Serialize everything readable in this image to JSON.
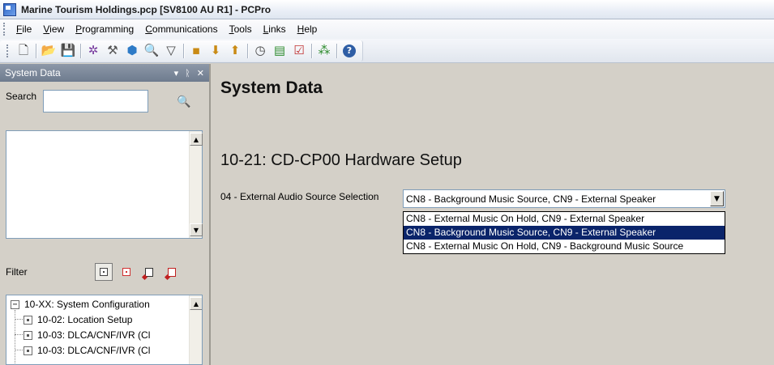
{
  "window": {
    "title": "Marine Tourism Holdings.pcp [SV8100 AU R1] - PCPro"
  },
  "menu": {
    "items": [
      {
        "mnemonic": "F",
        "rest": "ile"
      },
      {
        "mnemonic": "V",
        "rest": "iew"
      },
      {
        "mnemonic": "P",
        "rest": "rogramming"
      },
      {
        "mnemonic": "C",
        "rest": "ommunications"
      },
      {
        "mnemonic": "T",
        "rest": "ools"
      },
      {
        "mnemonic": "L",
        "rest": "inks"
      },
      {
        "mnemonic": "H",
        "rest": "elp"
      }
    ]
  },
  "toolbar": {
    "buttons": [
      {
        "icon": "new-file-icon",
        "glyph": "🗋",
        "color": "#3a3a3a"
      },
      {
        "icon": "open-folder-icon",
        "glyph": "📂",
        "color": "#d9a514"
      },
      {
        "icon": "save-icon",
        "glyph": "💾",
        "color": "#2f5ea5"
      },
      {
        "icon": "settings-gear-icon",
        "glyph": "✲",
        "color": "#7a3fa0"
      },
      {
        "icon": "wizard-icon",
        "glyph": "⚒",
        "color": "#555"
      },
      {
        "icon": "shield-icon",
        "glyph": "⬢",
        "color": "#2e7bc7"
      },
      {
        "icon": "search-icon",
        "glyph": "🔍",
        "color": "#444"
      },
      {
        "icon": "filter-icon",
        "glyph": "▽",
        "color": "#444"
      },
      {
        "icon": "connect-icon",
        "glyph": "▪",
        "color": "#c98a14"
      },
      {
        "icon": "download-icon",
        "glyph": "⬇",
        "color": "#c98a14"
      },
      {
        "icon": "upload-icon",
        "glyph": "⬆",
        "color": "#c98a14"
      },
      {
        "icon": "clock-icon",
        "glyph": "◷",
        "color": "#444"
      },
      {
        "icon": "database-icon",
        "glyph": "▤",
        "color": "#2d8b2d"
      },
      {
        "icon": "checklist-icon",
        "glyph": "☑",
        "color": "#c03030"
      },
      {
        "icon": "network-icon",
        "glyph": "⁂",
        "color": "#2d8b2d"
      },
      {
        "icon": "help-icon",
        "glyph": "?",
        "color": "#2f5ea5"
      }
    ]
  },
  "left_panel": {
    "header": {
      "title": "System Data",
      "dropdown_glyph": "▾",
      "pin_glyph": "ᚱ",
      "close_glyph": "✕"
    },
    "search": {
      "label": "Search",
      "value": ""
    },
    "filter": {
      "label": "Filter"
    },
    "tree": {
      "items": [
        {
          "toggle": "−",
          "label": "10-XX: System Configuration"
        },
        {
          "label": "10-02: Location Setup"
        },
        {
          "label": "10-03: DLCA/CNF/IVR (Cl"
        },
        {
          "label": "10-03: DLCA/CNF/IVR (Cl"
        }
      ]
    }
  },
  "main": {
    "page_title": "System Data",
    "section_title": "10-21: CD-CP00 Hardware Setup",
    "field": {
      "label": "04 - External Audio Source Selection",
      "selected_value": "CN8 - Background Music Source, CN9 - External Speaker",
      "options": [
        "CN8 - External Music On Hold, CN9 - External Speaker",
        "CN8 - Background Music Source, CN9 - External Speaker",
        "CN8 - External Music On Hold, CN9 - Background Music Source"
      ]
    }
  }
}
